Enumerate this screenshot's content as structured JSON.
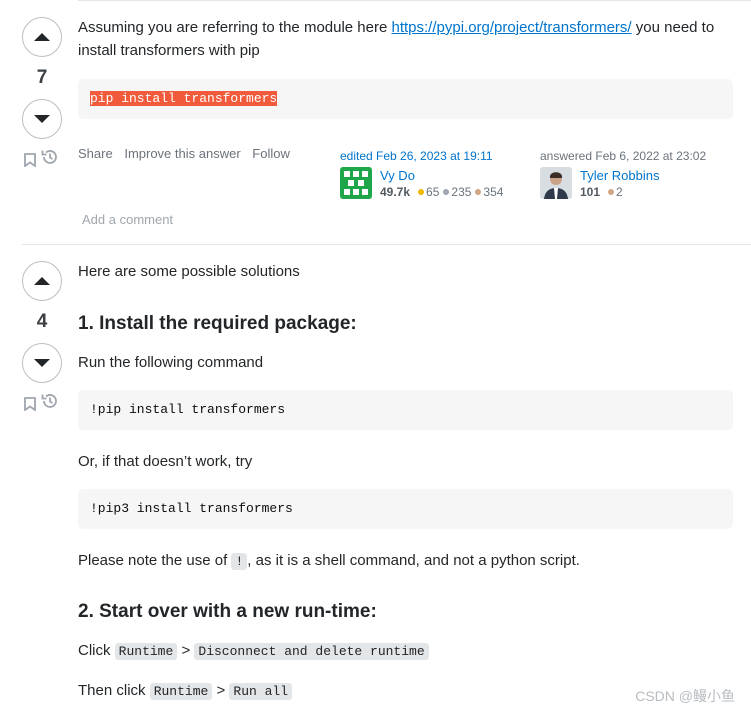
{
  "answers": [
    {
      "score": "7",
      "intro_before": "Assuming you are referring to the module here ",
      "intro_link": "https://pypi.org/project/transformers/",
      "intro_after": " you need to install transformers with pip",
      "code": "pip install transformers",
      "menu": [
        "Share",
        "Improve this answer",
        "Follow"
      ],
      "editor": {
        "action": "edited Feb 26, 2023 at 19:11",
        "name": "Vy Do",
        "rep": "49.7k",
        "gold": "65",
        "silver": "235",
        "bronze": "354"
      },
      "author": {
        "action": "answered Feb 6, 2022 at 23:02",
        "name": "Tyler Robbins",
        "rep": "101",
        "bronze": "2"
      },
      "add_comment": "Add a comment"
    },
    {
      "score": "4",
      "intro": "Here are some possible solutions",
      "h1": "1. Install the required package:",
      "p1": "Run the following command",
      "code1": "!pip install transformers",
      "p2": "Or, if that doesn’t work, try",
      "code2": "!pip3 install transformers",
      "p3_before": "Please note the use of ",
      "p3_code": "!",
      "p3_after": ", as it is a shell command, and not a python script.",
      "h2": "2. Start over with a new run-time:",
      "p4_label": "Click",
      "p4_code1": "Runtime",
      "p4_sep": ">",
      "p4_code2": "Disconnect and delete runtime",
      "p5_label": "Then click",
      "p5_code1": "Runtime",
      "p5_sep": ">",
      "p5_code2": "Run all"
    }
  ],
  "watermark": "CSDN @鳗小鱼",
  "icons": {
    "upvote": "arrow-up-icon",
    "downvote": "arrow-down-icon",
    "bookmark": "bookmark-icon",
    "history": "history-icon"
  }
}
